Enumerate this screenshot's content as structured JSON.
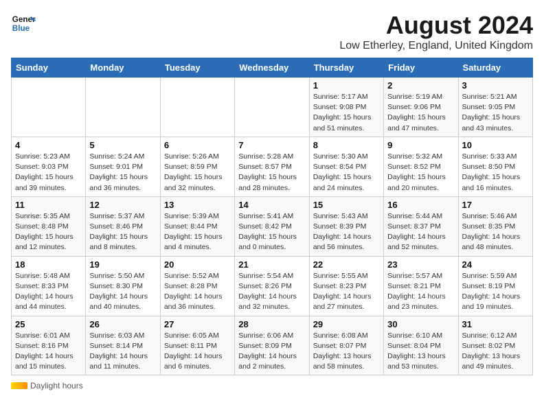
{
  "header": {
    "logo_line1": "General",
    "logo_line2": "Blue",
    "month_title": "August 2024",
    "location": "Low Etherley, England, United Kingdom"
  },
  "footer": {
    "daylight_label": "Daylight hours"
  },
  "calendar": {
    "weekdays": [
      "Sunday",
      "Monday",
      "Tuesday",
      "Wednesday",
      "Thursday",
      "Friday",
      "Saturday"
    ],
    "weeks": [
      [
        {
          "day": "",
          "info": ""
        },
        {
          "day": "",
          "info": ""
        },
        {
          "day": "",
          "info": ""
        },
        {
          "day": "",
          "info": ""
        },
        {
          "day": "1",
          "info": "Sunrise: 5:17 AM\nSunset: 9:08 PM\nDaylight: 15 hours and 51 minutes."
        },
        {
          "day": "2",
          "info": "Sunrise: 5:19 AM\nSunset: 9:06 PM\nDaylight: 15 hours and 47 minutes."
        },
        {
          "day": "3",
          "info": "Sunrise: 5:21 AM\nSunset: 9:05 PM\nDaylight: 15 hours and 43 minutes."
        }
      ],
      [
        {
          "day": "4",
          "info": "Sunrise: 5:23 AM\nSunset: 9:03 PM\nDaylight: 15 hours and 39 minutes."
        },
        {
          "day": "5",
          "info": "Sunrise: 5:24 AM\nSunset: 9:01 PM\nDaylight: 15 hours and 36 minutes."
        },
        {
          "day": "6",
          "info": "Sunrise: 5:26 AM\nSunset: 8:59 PM\nDaylight: 15 hours and 32 minutes."
        },
        {
          "day": "7",
          "info": "Sunrise: 5:28 AM\nSunset: 8:57 PM\nDaylight: 15 hours and 28 minutes."
        },
        {
          "day": "8",
          "info": "Sunrise: 5:30 AM\nSunset: 8:54 PM\nDaylight: 15 hours and 24 minutes."
        },
        {
          "day": "9",
          "info": "Sunrise: 5:32 AM\nSunset: 8:52 PM\nDaylight: 15 hours and 20 minutes."
        },
        {
          "day": "10",
          "info": "Sunrise: 5:33 AM\nSunset: 8:50 PM\nDaylight: 15 hours and 16 minutes."
        }
      ],
      [
        {
          "day": "11",
          "info": "Sunrise: 5:35 AM\nSunset: 8:48 PM\nDaylight: 15 hours and 12 minutes."
        },
        {
          "day": "12",
          "info": "Sunrise: 5:37 AM\nSunset: 8:46 PM\nDaylight: 15 hours and 8 minutes."
        },
        {
          "day": "13",
          "info": "Sunrise: 5:39 AM\nSunset: 8:44 PM\nDaylight: 15 hours and 4 minutes."
        },
        {
          "day": "14",
          "info": "Sunrise: 5:41 AM\nSunset: 8:42 PM\nDaylight: 15 hours and 0 minutes."
        },
        {
          "day": "15",
          "info": "Sunrise: 5:43 AM\nSunset: 8:39 PM\nDaylight: 14 hours and 56 minutes."
        },
        {
          "day": "16",
          "info": "Sunrise: 5:44 AM\nSunset: 8:37 PM\nDaylight: 14 hours and 52 minutes."
        },
        {
          "day": "17",
          "info": "Sunrise: 5:46 AM\nSunset: 8:35 PM\nDaylight: 14 hours and 48 minutes."
        }
      ],
      [
        {
          "day": "18",
          "info": "Sunrise: 5:48 AM\nSunset: 8:33 PM\nDaylight: 14 hours and 44 minutes."
        },
        {
          "day": "19",
          "info": "Sunrise: 5:50 AM\nSunset: 8:30 PM\nDaylight: 14 hours and 40 minutes."
        },
        {
          "day": "20",
          "info": "Sunrise: 5:52 AM\nSunset: 8:28 PM\nDaylight: 14 hours and 36 minutes."
        },
        {
          "day": "21",
          "info": "Sunrise: 5:54 AM\nSunset: 8:26 PM\nDaylight: 14 hours and 32 minutes."
        },
        {
          "day": "22",
          "info": "Sunrise: 5:55 AM\nSunset: 8:23 PM\nDaylight: 14 hours and 27 minutes."
        },
        {
          "day": "23",
          "info": "Sunrise: 5:57 AM\nSunset: 8:21 PM\nDaylight: 14 hours and 23 minutes."
        },
        {
          "day": "24",
          "info": "Sunrise: 5:59 AM\nSunset: 8:19 PM\nDaylight: 14 hours and 19 minutes."
        }
      ],
      [
        {
          "day": "25",
          "info": "Sunrise: 6:01 AM\nSunset: 8:16 PM\nDaylight: 14 hours and 15 minutes."
        },
        {
          "day": "26",
          "info": "Sunrise: 6:03 AM\nSunset: 8:14 PM\nDaylight: 14 hours and 11 minutes."
        },
        {
          "day": "27",
          "info": "Sunrise: 6:05 AM\nSunset: 8:11 PM\nDaylight: 14 hours and 6 minutes."
        },
        {
          "day": "28",
          "info": "Sunrise: 6:06 AM\nSunset: 8:09 PM\nDaylight: 14 hours and 2 minutes."
        },
        {
          "day": "29",
          "info": "Sunrise: 6:08 AM\nSunset: 8:07 PM\nDaylight: 13 hours and 58 minutes."
        },
        {
          "day": "30",
          "info": "Sunrise: 6:10 AM\nSunset: 8:04 PM\nDaylight: 13 hours and 53 minutes."
        },
        {
          "day": "31",
          "info": "Sunrise: 6:12 AM\nSunset: 8:02 PM\nDaylight: 13 hours and 49 minutes."
        }
      ]
    ]
  }
}
